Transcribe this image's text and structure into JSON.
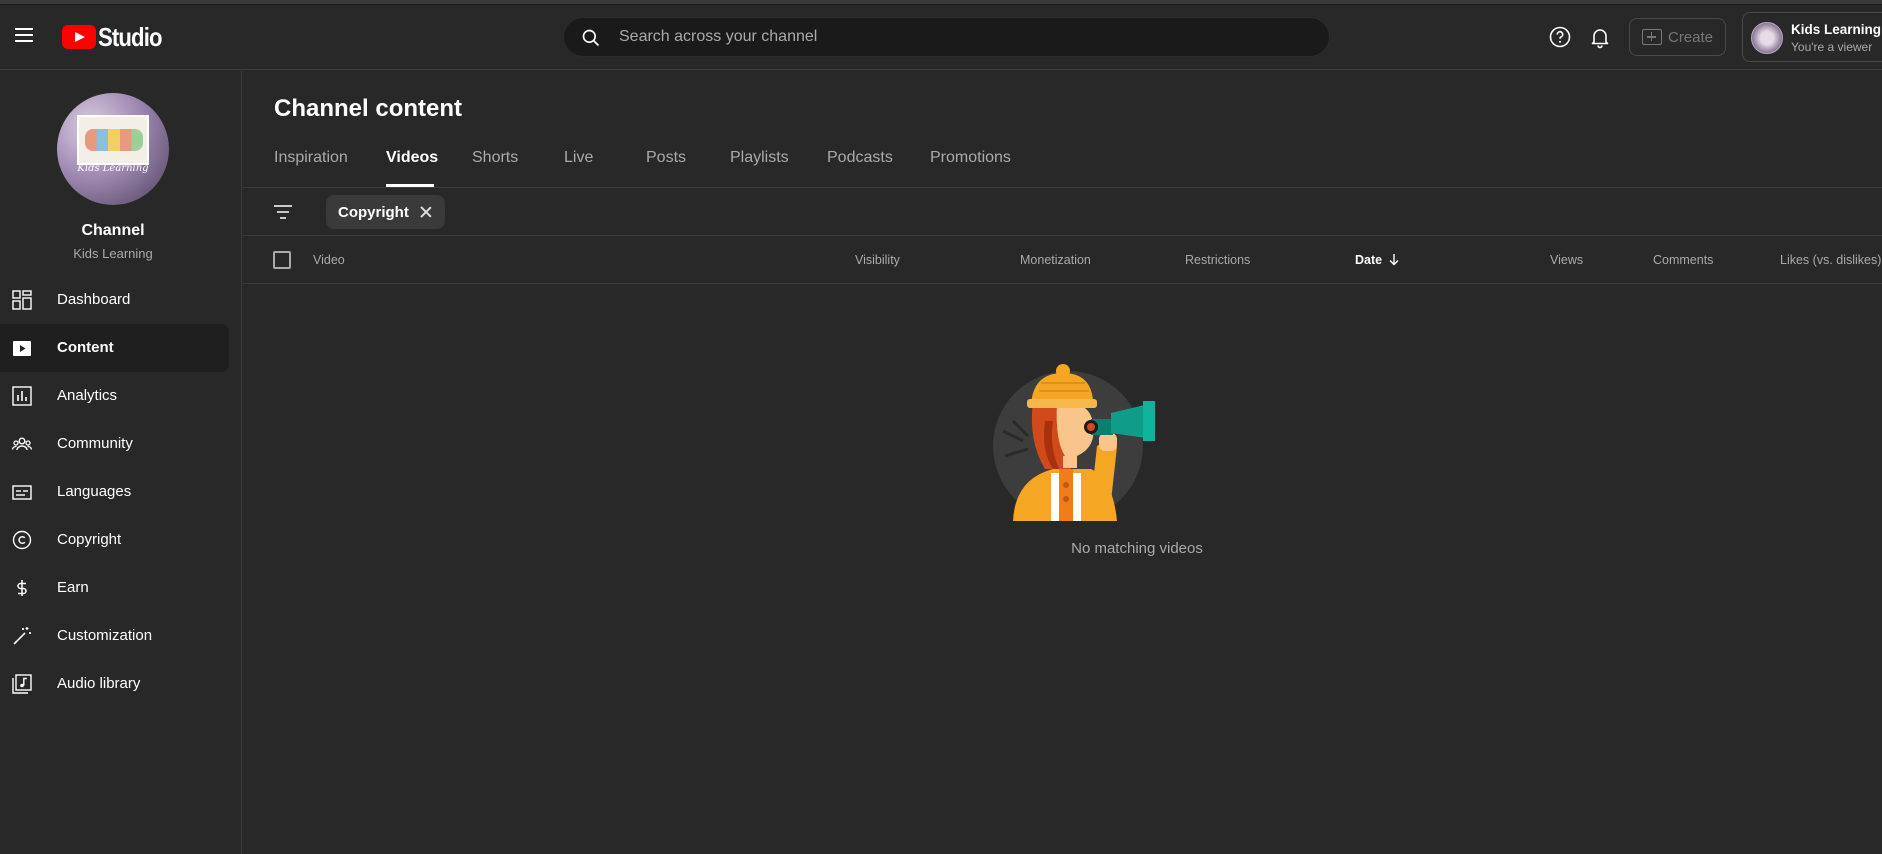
{
  "header": {
    "logo_text": "Studio",
    "search_placeholder": "Search across your channel",
    "create_label": "Create",
    "account_name": "Kids Learning",
    "account_role": "You're a viewer",
    "icons": [
      "menu-icon",
      "search-icon",
      "help-icon",
      "bell-icon",
      "create-video-icon"
    ]
  },
  "sidebar": {
    "channel_title": "Channel",
    "channel_name": "Kids Learning",
    "avatar_caption": "Kids Learning",
    "items": [
      {
        "label": "Dashboard",
        "icon": "dashboard-icon",
        "active": false
      },
      {
        "label": "Content",
        "icon": "content-icon",
        "active": true
      },
      {
        "label": "Analytics",
        "icon": "analytics-icon",
        "active": false
      },
      {
        "label": "Community",
        "icon": "community-icon",
        "active": false
      },
      {
        "label": "Languages",
        "icon": "subtitles-icon",
        "active": false
      },
      {
        "label": "Copyright",
        "icon": "copyright-icon",
        "active": false
      },
      {
        "label": "Earn",
        "icon": "dollar-icon",
        "active": false
      },
      {
        "label": "Customization",
        "icon": "magic-wand-icon",
        "active": false
      },
      {
        "label": "Audio library",
        "icon": "audio-library-icon",
        "active": false
      }
    ]
  },
  "main": {
    "title": "Channel content",
    "tabs": [
      {
        "label": "Inspiration",
        "active": false
      },
      {
        "label": "Videos",
        "active": true
      },
      {
        "label": "Shorts",
        "active": false
      },
      {
        "label": "Live",
        "active": false
      },
      {
        "label": "Posts",
        "active": false
      },
      {
        "label": "Playlists",
        "active": false
      },
      {
        "label": "Podcasts",
        "active": false
      },
      {
        "label": "Promotions",
        "active": false
      }
    ],
    "filter_chip": "Copyright",
    "columns": [
      {
        "label": "Video",
        "sorted": false
      },
      {
        "label": "Visibility",
        "sorted": false
      },
      {
        "label": "Monetization",
        "sorted": false
      },
      {
        "label": "Restrictions",
        "sorted": false
      },
      {
        "label": "Date",
        "sorted": true
      },
      {
        "label": "Views",
        "sorted": false
      },
      {
        "label": "Comments",
        "sorted": false
      },
      {
        "label": "Likes (vs. dislikes)",
        "sorted": false
      }
    ],
    "empty_message": "No matching videos"
  },
  "colors": {
    "background": "#282828",
    "logo_red": "#ff0000",
    "text_secondary": "#aaaaaa",
    "illustration_orange": "#f5a623",
    "illustration_teal": "#0f9d8a"
  }
}
